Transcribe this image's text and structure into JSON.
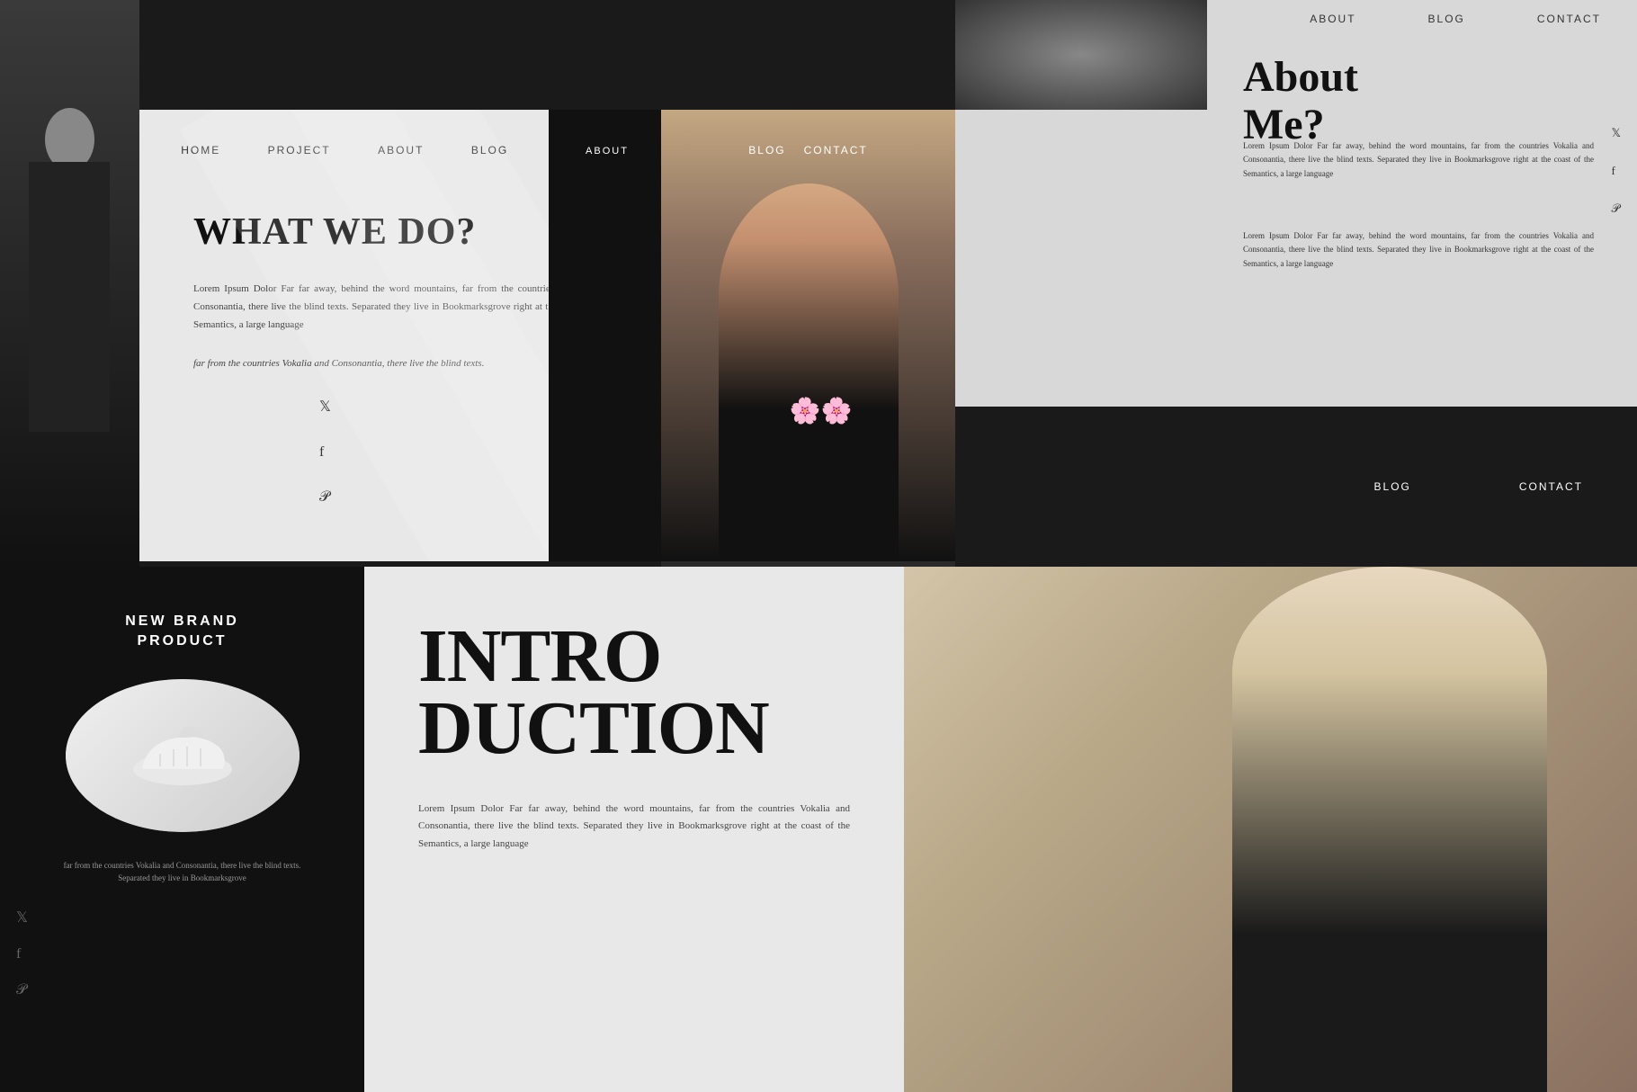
{
  "nav": {
    "home": "HOME",
    "project": "PROJECT",
    "about": "ABOUT",
    "blog": "BLOG",
    "contact": "CONTACT"
  },
  "main_panel": {
    "heading": "WHAT WE DO?",
    "body_text": "Lorem Ipsum Dolor Far far away, behind the word mountains, far from the countries Vokalia and Consonantia, there live the blind texts. Separated they live in Bookmarksgrove right at the coast of the Semantics, a large language",
    "italic_text": "far from the countries Vokalia and Consonantia, there live the blind texts."
  },
  "about_panel": {
    "heading_line1": "About",
    "heading_line2": "Me?",
    "body1": "Lorem Ipsum Dolor Far far away, behind the word mountains, far from the countries Vokalia and Consonantia, there live the blind texts. Separated they live in Bookmarksgrove right at the coast of the Semantics, a large language",
    "body2": "Lorem Ipsum Dolor Far far away, behind the word mountains, far from the countries Vokalia and Consonantia, there live the blind texts. Separated they live in Bookmarksgrove right at the coast of the Semantics, a large language",
    "blog_link": "BLOG",
    "contact_link": "CONTACT"
  },
  "brand_panel": {
    "title_line1": "NEW BRAND",
    "title_line2": "PRODUCT",
    "caption": "far from the countries Vokalia and Consonantia, there live the blind texts. Separated they live in Bookmarksgrove"
  },
  "intro_panel": {
    "heading_line1": "INTRO",
    "heading_line2": "DUCTION",
    "body": "Lorem Ipsum Dolor Far far away, behind the word mountains, far from the countries Vokalia and Consonantia, there live the blind texts. Separated they live in Bookmarksgrove right at the coast of the Semantics, a large language"
  },
  "social": {
    "twitter": "𝕏",
    "facebook": "f",
    "pinterest": "𝒫"
  },
  "header_contact": "CONTACT"
}
